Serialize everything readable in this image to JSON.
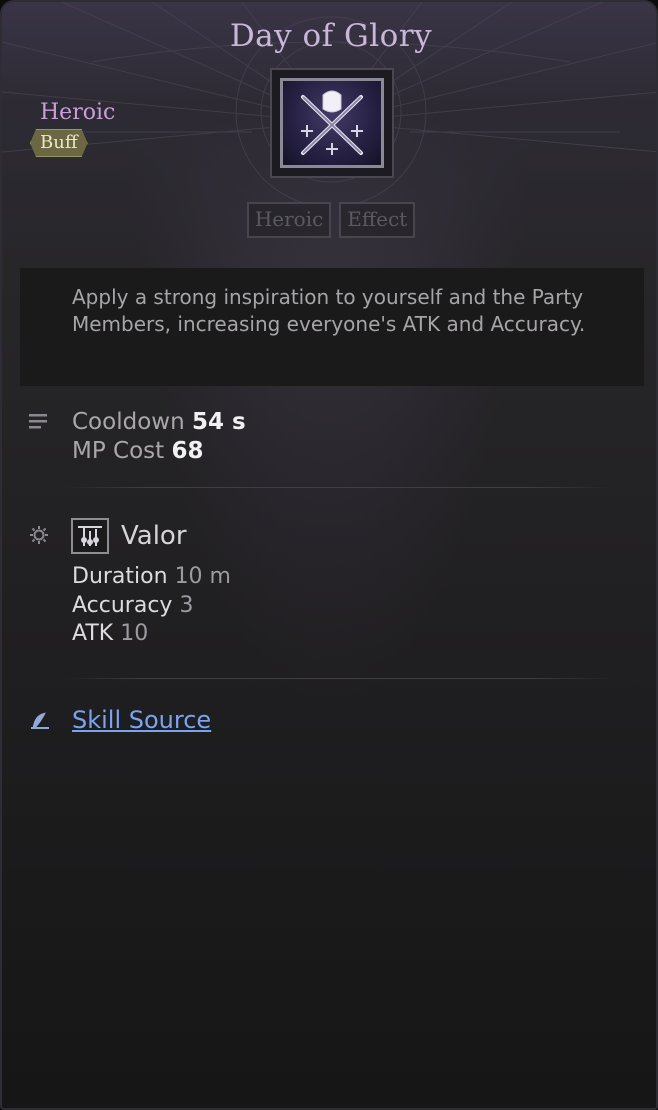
{
  "skill": {
    "title": "Day of Glory",
    "grade": "Heroic",
    "type": "Buff",
    "icon": "crossed-swords-with-fist-icon",
    "tags": [
      "Heroic",
      "Effect"
    ],
    "description": "Apply a strong inspiration to yourself and the Party Members, increasing everyone's ATK and Accuracy."
  },
  "stats": {
    "cooldown_label": "Cooldown",
    "cooldown_value": "54 s",
    "mp_label": "MP Cost",
    "mp_value": "68"
  },
  "effect": {
    "name": "Valor",
    "icon": "valor-buff-icon",
    "lines": [
      {
        "label": "Duration",
        "value": "10 m"
      },
      {
        "label": "Accuracy",
        "value": "3"
      },
      {
        "label": "ATK",
        "value": "10"
      }
    ]
  },
  "source": {
    "label": "Skill Source",
    "icon": "feather-quill-icon"
  },
  "colors": {
    "title": "#c9b7da",
    "grade": "#c99fdb",
    "badge": "#6a6742",
    "link": "#7aa4ef"
  }
}
